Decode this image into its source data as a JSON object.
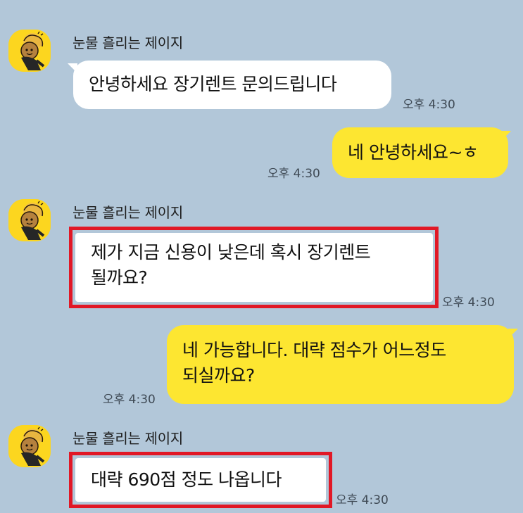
{
  "chat": {
    "background_color": "#b2c7d9",
    "sent_bubble_color": "#fde631",
    "received_bubble_color": "#ffffff",
    "highlight_color": "#e11826",
    "messages": [
      {
        "direction": "received",
        "sender": "눈물 흘리는 제이지",
        "avatar_icon": "ryan-character-icon",
        "text": "안녕하세요 장기렌트 문의드립니다",
        "time": "오후 4:30",
        "highlighted": false
      },
      {
        "direction": "sent",
        "text": "네 안녕하세요~ㅎ",
        "time": "오후 4:30"
      },
      {
        "direction": "received",
        "sender": "눈물 흘리는 제이지",
        "avatar_icon": "ryan-character-icon",
        "text": "제가 지금 신용이 낮은데 혹시 장기렌트\n될까요?",
        "time": "오후 4:30",
        "highlighted": true
      },
      {
        "direction": "sent",
        "text": "네 가능합니다. 대략 점수가 어느정도\n되실까요?",
        "time": "오후 4:30"
      },
      {
        "direction": "received",
        "sender": "눈물 흘리는 제이지",
        "avatar_icon": "ryan-character-icon",
        "text": "대략 690점 정도 나옵니다",
        "time": "오후 4:30",
        "highlighted": true
      }
    ]
  }
}
